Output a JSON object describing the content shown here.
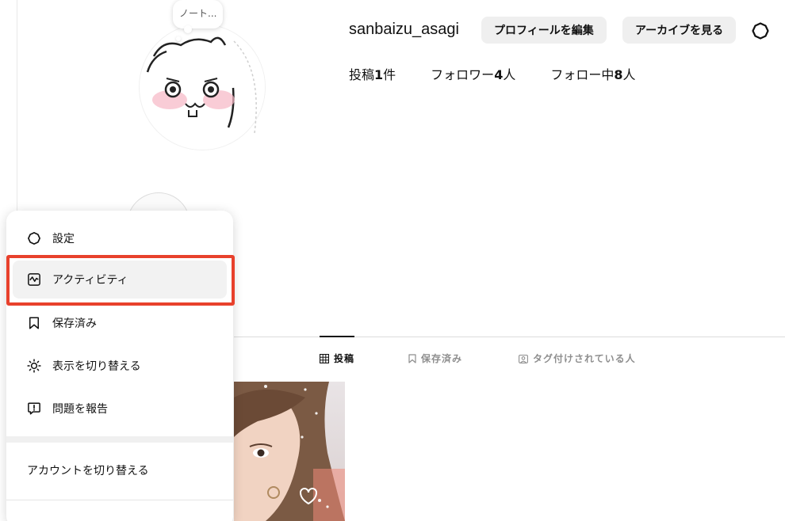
{
  "profile": {
    "username": "sanbaizu_asagi",
    "note": "ノート...",
    "edit_button": "プロフィールを編集",
    "archive_button": "アーカイブを見る",
    "stats": [
      {
        "label": "投稿",
        "value": "1",
        "suffix": "件"
      },
      {
        "label": "フォロワー",
        "value": "4",
        "suffix": "人"
      },
      {
        "label": "フォロー中",
        "value": "8",
        "suffix": "人"
      }
    ]
  },
  "tabs": [
    {
      "label": "投稿",
      "icon": "grid-icon",
      "active": true
    },
    {
      "label": "保存済み",
      "icon": "bookmark-icon",
      "active": false
    },
    {
      "label": "タグ付けされている人",
      "icon": "tagged-user-icon",
      "active": false
    }
  ],
  "menu": {
    "items": [
      {
        "label": "設定",
        "icon": "gear-icon"
      },
      {
        "label": "アクティビティ",
        "icon": "activity-icon"
      },
      {
        "label": "保存済み",
        "icon": "bookmark-icon"
      },
      {
        "label": "表示を切り替える",
        "icon": "sun-icon"
      },
      {
        "label": "問題を報告",
        "icon": "report-icon"
      }
    ],
    "switch_account": "アカウントを切り替える",
    "highlight_color": "#e8412c"
  },
  "colors": {
    "button_bg": "#efefef",
    "menu_hover": "#f2f2f2",
    "muted_text": "#8e8e8e"
  }
}
